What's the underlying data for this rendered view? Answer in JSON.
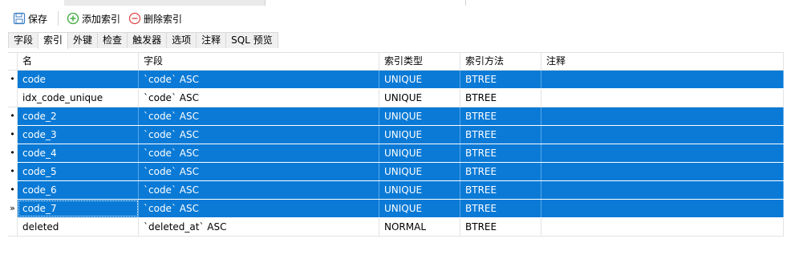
{
  "toolbar": {
    "save_label": "保存",
    "add_index_label": "添加索引",
    "delete_index_label": "删除索引"
  },
  "tabs": [
    {
      "label": "字段",
      "active": false
    },
    {
      "label": "索引",
      "active": true
    },
    {
      "label": "外键",
      "active": false
    },
    {
      "label": "检查",
      "active": false
    },
    {
      "label": "触发器",
      "active": false
    },
    {
      "label": "选项",
      "active": false
    },
    {
      "label": "注释",
      "active": false
    },
    {
      "label": "SQL 预览",
      "active": false
    }
  ],
  "grid": {
    "columns": [
      "名",
      "字段",
      "索引类型",
      "索引方法",
      "注释"
    ],
    "rows": [
      {
        "marker": "•",
        "selected": true,
        "name": "code",
        "fields": "`code` ASC",
        "type": "UNIQUE",
        "method": "BTREE",
        "comment": ""
      },
      {
        "marker": "",
        "selected": false,
        "name": "idx_code_unique",
        "fields": "`code` ASC",
        "type": "UNIQUE",
        "method": "BTREE",
        "comment": ""
      },
      {
        "marker": "•",
        "selected": true,
        "name": "code_2",
        "fields": "`code` ASC",
        "type": "UNIQUE",
        "method": "BTREE",
        "comment": ""
      },
      {
        "marker": "•",
        "selected": true,
        "name": "code_3",
        "fields": "`code` ASC",
        "type": "UNIQUE",
        "method": "BTREE",
        "comment": ""
      },
      {
        "marker": "•",
        "selected": true,
        "name": "code_4",
        "fields": "`code` ASC",
        "type": "UNIQUE",
        "method": "BTREE",
        "comment": ""
      },
      {
        "marker": "•",
        "selected": true,
        "name": "code_5",
        "fields": "`code` ASC",
        "type": "UNIQUE",
        "method": "BTREE",
        "comment": ""
      },
      {
        "marker": "•",
        "selected": true,
        "name": "code_6",
        "fields": "`code` ASC",
        "type": "UNIQUE",
        "method": "BTREE",
        "comment": ""
      },
      {
        "marker": "»",
        "selected": true,
        "name": "code_7",
        "fields": "`code` ASC",
        "type": "UNIQUE",
        "method": "BTREE",
        "comment": "",
        "current": true
      },
      {
        "marker": "",
        "selected": false,
        "name": "deleted",
        "fields": "`deleted_at` ASC",
        "type": "NORMAL",
        "method": "BTREE",
        "comment": ""
      }
    ]
  },
  "colors": {
    "selection": "#0a7ad6",
    "add_icon": "#3aa63a",
    "delete_icon": "#e04b4b",
    "save_icon": "#3d7fc4"
  }
}
